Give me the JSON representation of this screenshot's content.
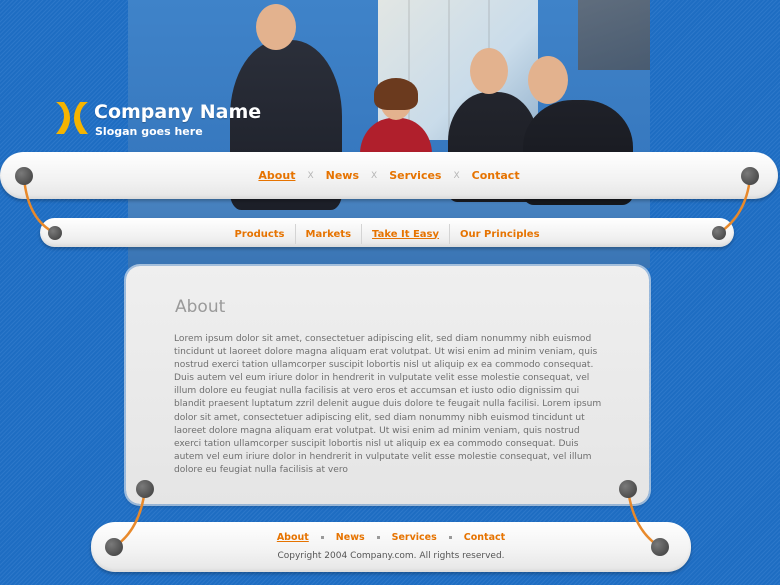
{
  "header": {
    "company_name": "Company Name",
    "slogan": "Slogan goes here"
  },
  "main_nav": {
    "items": [
      {
        "label": "About",
        "active": true
      },
      {
        "label": "News",
        "active": false
      },
      {
        "label": "Services",
        "active": false
      },
      {
        "label": "Contact",
        "active": false
      }
    ],
    "separator": "X"
  },
  "sub_nav": {
    "items": [
      {
        "label": "Products",
        "active": false
      },
      {
        "label": "Markets",
        "active": false
      },
      {
        "label": "Take It Easy",
        "active": true
      },
      {
        "label": "Our Principles",
        "active": false
      }
    ]
  },
  "content": {
    "title": "About",
    "body": "Lorem ipsum dolor sit amet, consectetuer adipiscing elit, sed diam nonummy nibh euismod tincidunt ut laoreet dolore magna aliquam erat volutpat. Ut wisi enim ad minim veniam, quis nostrud exerci tation ullamcorper suscipit lobortis nisl ut aliquip ex ea commodo consequat. Duis autem vel eum iriure dolor in hendrerit in vulputate velit esse molestie consequat, vel illum dolore eu feugiat nulla facilisis at vero eros et accumsan et iusto odio dignissim qui blandit praesent luptatum zzril delenit augue duis dolore te feugait nulla facilisi. Lorem ipsum dolor sit amet, consectetuer adipiscing elit, sed diam nonummy nibh euismod tincidunt ut laoreet dolore magna aliquam erat volutpat. Ut wisi enim ad minim veniam, quis nostrud exerci tation ullamcorper suscipit lobortis nisl ut aliquip ex ea commodo consequat. Duis autem vel eum iriure dolor in hendrerit in vulputate velit esse molestie consequat, vel illum dolore eu feugiat nulla facilisis at vero"
  },
  "footer": {
    "items": [
      {
        "label": "About",
        "active": true
      },
      {
        "label": "News",
        "active": false
      },
      {
        "label": "Services",
        "active": false
      },
      {
        "label": "Contact",
        "active": false
      }
    ],
    "copyright": "Copyright 2004 Company.com. All rights reserved."
  },
  "colors": {
    "background": "#1f6fc6",
    "accent": "#e67300",
    "logo": "#f5b400"
  }
}
